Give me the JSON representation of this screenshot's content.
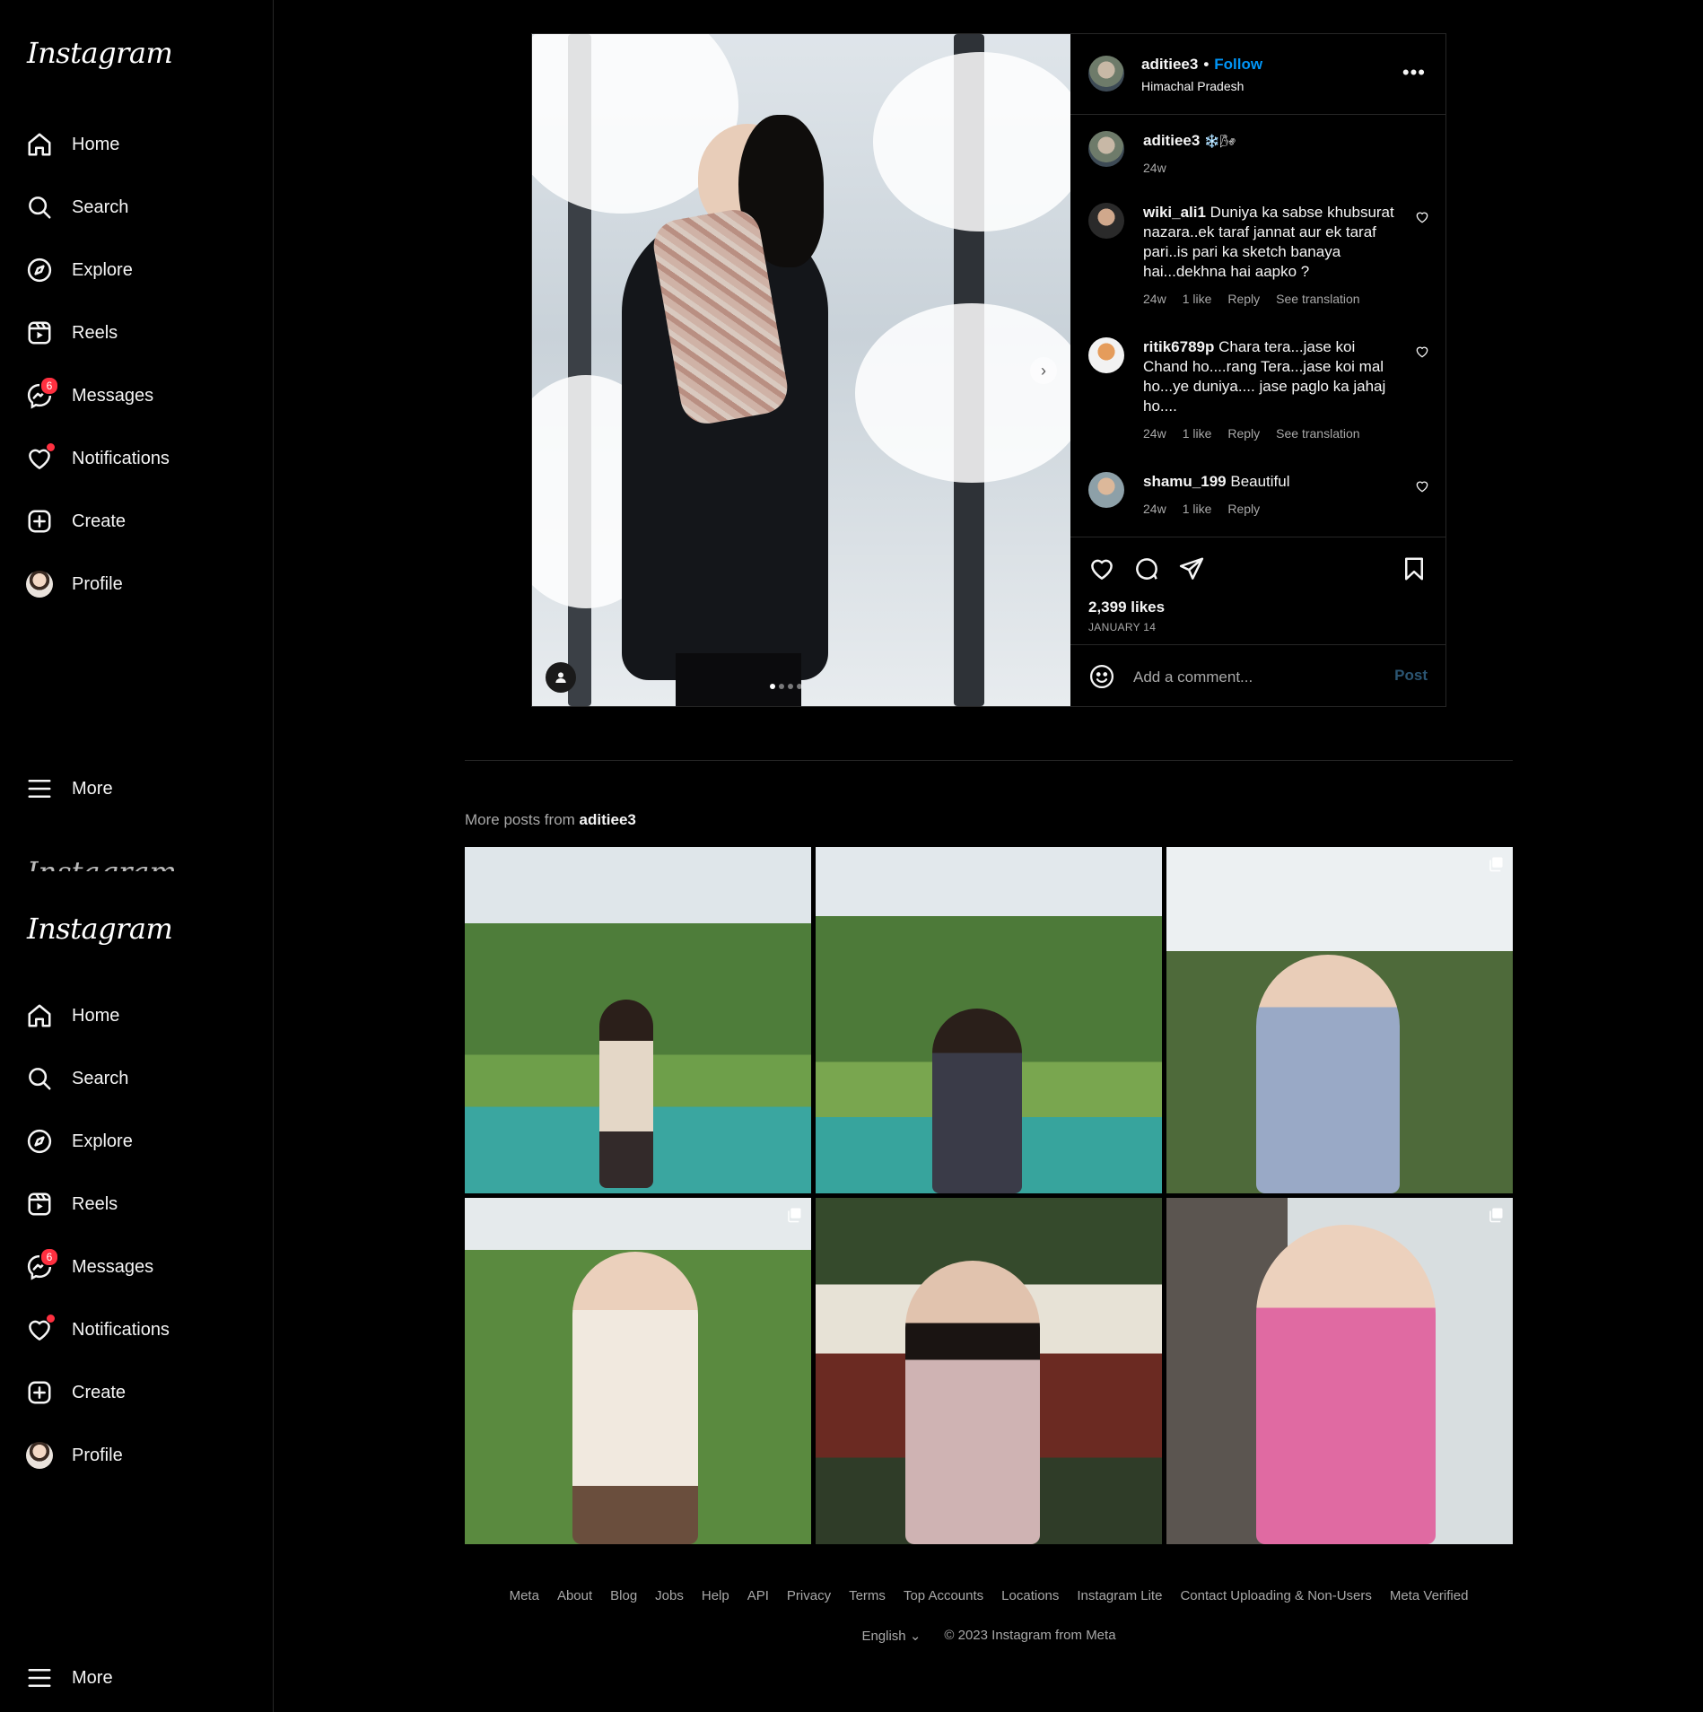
{
  "sidebar": {
    "logo": "Instagram",
    "items": [
      {
        "label": "Home"
      },
      {
        "label": "Search"
      },
      {
        "label": "Explore"
      },
      {
        "label": "Reels"
      },
      {
        "label": "Messages",
        "badge": "6"
      },
      {
        "label": "Notifications"
      },
      {
        "label": "Create"
      },
      {
        "label": "Profile"
      }
    ],
    "more": "More"
  },
  "post": {
    "username": "aditiee3",
    "separator": "•",
    "follow": "Follow",
    "location": "Himachal Pradesh",
    "caption": {
      "username": "aditiee3",
      "text": "❄️🌬",
      "time": "24w"
    },
    "comments": [
      {
        "username": "wiki_ali1",
        "text": "Duniya ka sabse khubsurat nazara..ek taraf jannat aur ek taraf pari..is pari ka sketch banaya hai...dekhna hai aapko ?",
        "time": "24w",
        "likes": "1 like",
        "reply": "Reply",
        "translate": "See translation"
      },
      {
        "username": "ritik6789p",
        "text": "Chara tera...jase koi Chand ho....rang Tera...jase koi mal ho...ye duniya.... jase paglo ka jahaj ho....",
        "time": "24w",
        "likes": "1 like",
        "reply": "Reply",
        "translate": "See translation"
      },
      {
        "username": "shamu_199",
        "text": "Beautiful",
        "time": "24w",
        "likes": "1 like",
        "reply": "Reply"
      }
    ],
    "likes": "2,399 likes",
    "date": "JANUARY 14",
    "comment_placeholder": "Add a comment...",
    "post_button": "Post",
    "carousel_total": 4,
    "carousel_active": 1
  },
  "more_posts": {
    "prefix": "More posts from",
    "username": "aditiee3"
  },
  "footer": {
    "links": [
      "Meta",
      "About",
      "Blog",
      "Jobs",
      "Help",
      "API",
      "Privacy",
      "Terms",
      "Top Accounts",
      "Locations",
      "Instagram Lite",
      "Contact Uploading & Non-Users",
      "Meta Verified"
    ],
    "language": "English",
    "copyright": "© 2023 Instagram from Meta"
  },
  "colors": {
    "accent": "#0095f6",
    "badge": "#ff3040",
    "background": "#000000"
  }
}
